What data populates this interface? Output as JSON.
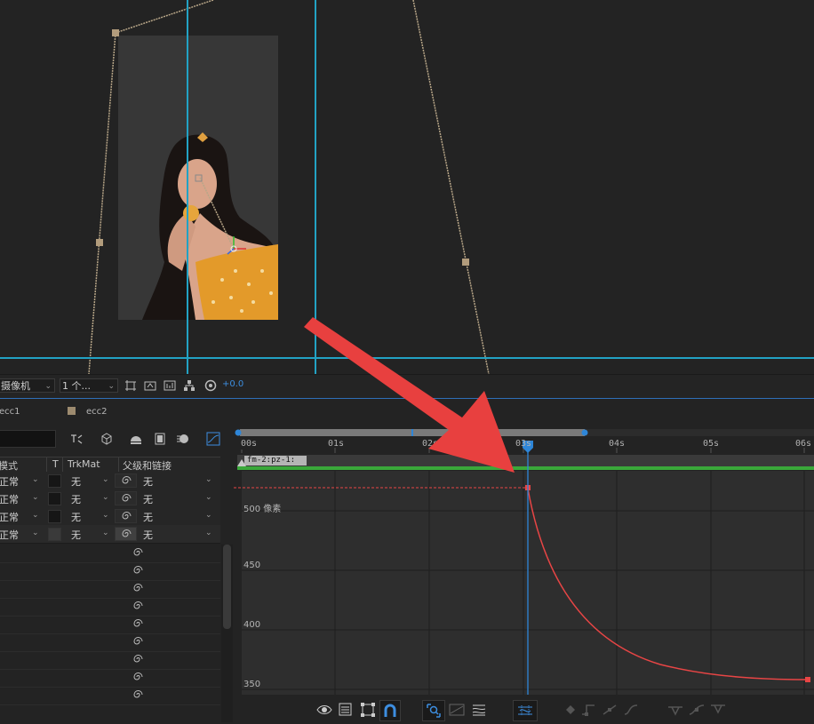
{
  "viewer_toolbar": {
    "camera_select": "摄像机",
    "view_select": "1 个...",
    "exposure": "+0.0"
  },
  "comp_tabs": [
    {
      "name": "ecc1"
    },
    {
      "name": "ecc2",
      "swatch_color": "#9d8b6f"
    }
  ],
  "layer_columns": {
    "mode": "模式",
    "t": "T",
    "trkmat": "TrkMat",
    "parent": "父级和链接"
  },
  "layers": [
    {
      "mode": "正常",
      "trkmat": "无",
      "parent": "无"
    },
    {
      "mode": "正常",
      "trkmat": "无",
      "parent": "无"
    },
    {
      "mode": "正常",
      "trkmat": "无",
      "parent": "无"
    },
    {
      "mode": "正常",
      "trkmat": "无",
      "parent": "无"
    }
  ],
  "property_rows_count": 9,
  "graph_editor": {
    "ruler_labels": [
      "00s",
      "01s",
      "02s",
      "03s",
      "04s",
      "05s",
      "06s"
    ],
    "layer_bar_label": "fm-2:pz-1:",
    "value_labels": [
      "500 像素",
      "450",
      "400",
      "350"
    ],
    "curve_color": "#e84545",
    "playhead_color": "#2e86d8",
    "workarea_color": "#3aa83a"
  },
  "annotation": {
    "arrow_color": "#e8403f"
  },
  "icons": {
    "viewer_toolbar": [
      "grid-toggle-icon",
      "snapshot-icon",
      "show-channel-icon",
      "region-of-interest-icon",
      "flowchart-icon",
      "color-settings-icon"
    ],
    "layer_panel": [
      "shy-layers-icon",
      "3d-layer-icon",
      "draft-3d-icon",
      "frame-blending-icon",
      "motion-blur-icon",
      "graph-editor-toggle-icon"
    ],
    "graph_toolbar": [
      "eye-icon",
      "graph-type-icon",
      "transform-box-icon",
      "snap-icon",
      "fit-selection-icon",
      "fit-all-icon",
      "edit-speed-icon",
      "separate-dimensions-icon",
      "keyframe-diamond-icon",
      "convert-hold-icon",
      "convert-auto-bezier-icon",
      "easy-ease-icon",
      "easy-ease-in-icon",
      "easy-ease-out-icon"
    ]
  }
}
